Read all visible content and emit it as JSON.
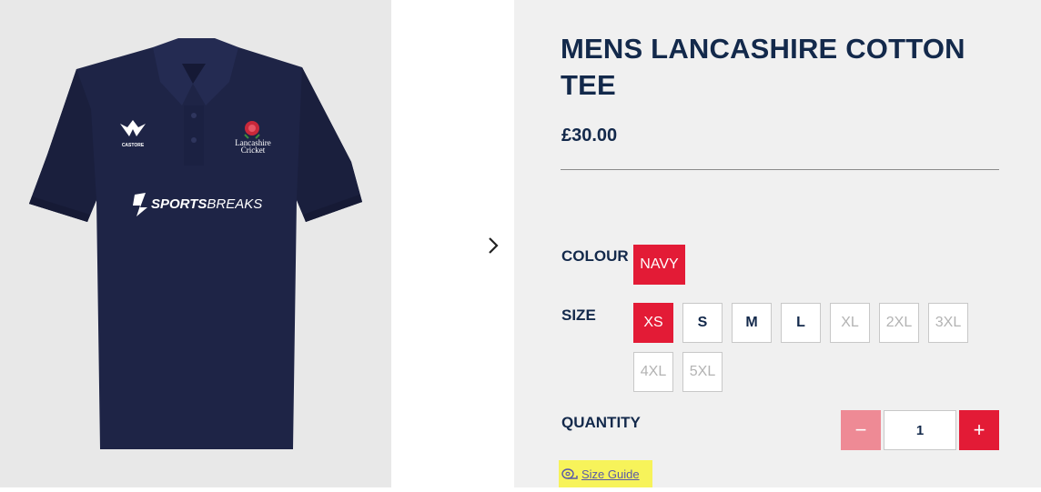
{
  "product": {
    "title": "MENS LANCASHIRE COTTON TEE",
    "price": "£30.00",
    "image": {
      "shirt_brand_logo": "CASTORE",
      "badge_text_line1": "Lancashire",
      "badge_text_line2": "Cricket",
      "sponsor_text_bold": "SPORTS",
      "sponsor_text_light": "BREAKS"
    }
  },
  "gallery": {
    "next_icon": "chevron-right-icon"
  },
  "colour": {
    "label": "COLOUR",
    "selected": "NAVY"
  },
  "size": {
    "label": "SIZE",
    "options": [
      {
        "label": "XS",
        "state": "selected"
      },
      {
        "label": "S",
        "state": "available"
      },
      {
        "label": "M",
        "state": "available"
      },
      {
        "label": "L",
        "state": "available"
      },
      {
        "label": "XL",
        "state": "unavailable"
      },
      {
        "label": "2XL",
        "state": "unavailable"
      },
      {
        "label": "3XL",
        "state": "unavailable"
      },
      {
        "label": "4XL",
        "state": "unavailable"
      },
      {
        "label": "5XL",
        "state": "unavailable"
      }
    ]
  },
  "quantity": {
    "label": "QUANTITY",
    "value": "1",
    "minus": "−",
    "plus": "+"
  },
  "size_guide": {
    "label": "Size Guide",
    "icon": "tape-measure-icon"
  },
  "colors": {
    "accent": "#e31b36",
    "navy": "#13294b",
    "disabled_minus": "#ee8a95",
    "highlight": "#f7f35a"
  }
}
